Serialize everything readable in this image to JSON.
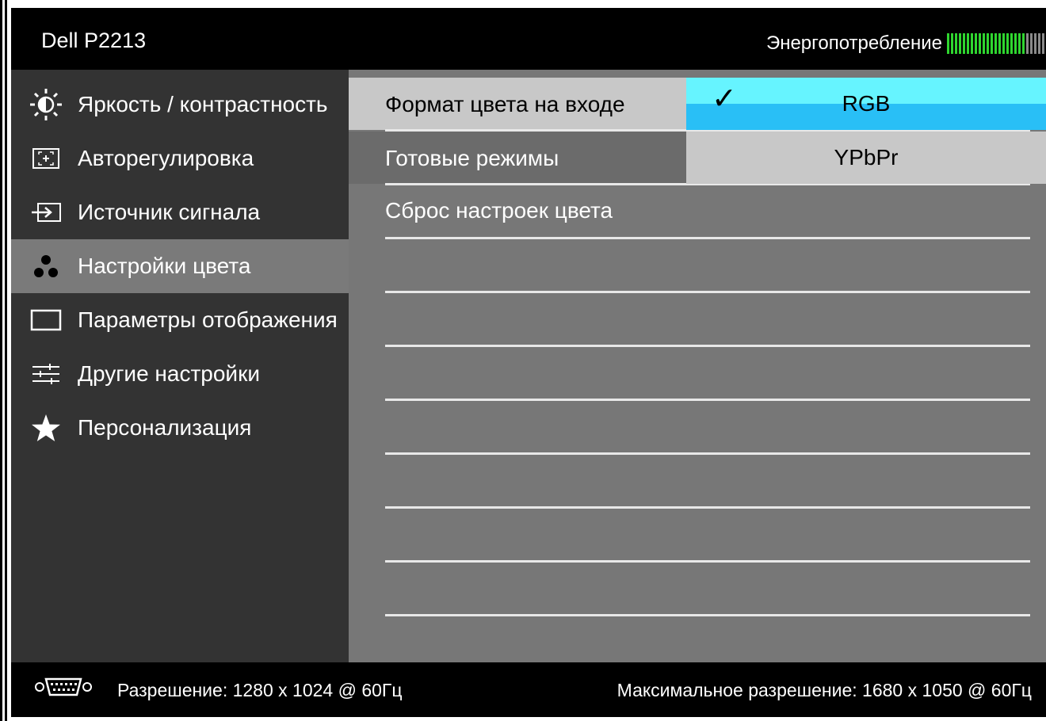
{
  "header": {
    "model": "Dell P2213",
    "power_label": "Энергопотребление",
    "power_level": 0.8,
    "power_colors": {
      "on": "#2fd62f",
      "off": "#8a8a8a"
    }
  },
  "left_menu": {
    "items": [
      {
        "label": "Яркость / контрастность",
        "icon": "brightness-icon"
      },
      {
        "label": "Авторегулировка",
        "icon": "auto-adjust-icon"
      },
      {
        "label": "Источник сигнала",
        "icon": "input-source-icon"
      },
      {
        "label": "Настройки цвета",
        "icon": "color-settings-icon",
        "selected": true
      },
      {
        "label": "Параметры отображения",
        "icon": "display-settings-icon"
      },
      {
        "label": "Другие настройки",
        "icon": "other-settings-icon"
      },
      {
        "label": "Персонализация",
        "icon": "star-icon"
      }
    ]
  },
  "submenu": {
    "items": [
      {
        "label": "Формат цвета на входе"
      },
      {
        "label": "Готовые режимы"
      },
      {
        "label": "Сброс настроек цвета"
      }
    ],
    "options": {
      "selected": "RGB",
      "other": "YPbPr",
      "check": "✓"
    }
  },
  "footer": {
    "resolution": "Разрешение: 1280 x 1024 @ 60Гц",
    "max_resolution": "Максимальное разрешение: 1680 x 1050 @ 60Гц",
    "icon": "vga-connector-icon"
  }
}
